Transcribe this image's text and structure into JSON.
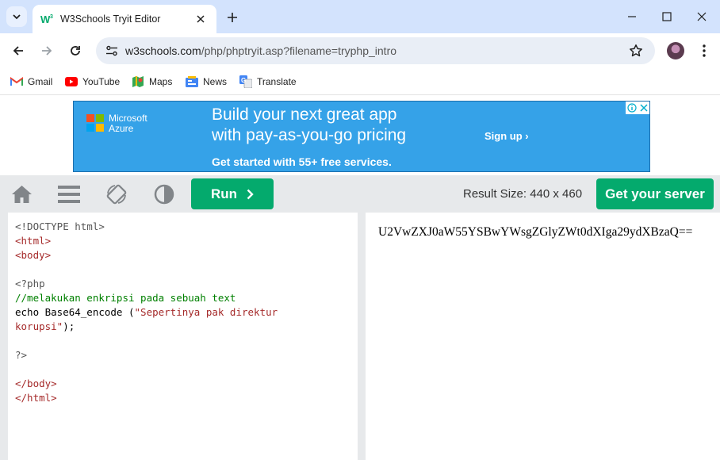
{
  "browser": {
    "tab": {
      "title": "W3Schools Tryit Editor"
    },
    "url": {
      "host": "w3schools.com",
      "path": "/php/phptryit.asp?filename=tryphp_intro"
    },
    "bookmarks": [
      {
        "label": "Gmail",
        "icon": "gmail-icon"
      },
      {
        "label": "YouTube",
        "icon": "youtube-icon"
      },
      {
        "label": "Maps",
        "icon": "maps-icon"
      },
      {
        "label": "News",
        "icon": "news-icon"
      },
      {
        "label": "Translate",
        "icon": "translate-icon"
      }
    ]
  },
  "ad": {
    "brand_line1": "Microsoft",
    "brand_line2": "Azure",
    "headline_line1": "Build your next great app",
    "headline_line2": "with pay-as-you-go pricing",
    "subline": "Get started with 55+ free services.",
    "cta": "Sign up ›"
  },
  "toolbar": {
    "run_label": "Run",
    "result_size": "Result Size: 440 x 460",
    "server_label": "Get your server"
  },
  "code": {
    "doctype": "<!DOCTYPE html>",
    "html_open": "<html>",
    "body_open": "<body>",
    "php_open": "<?php",
    "comment": "//melakukan enkripsi pada sebuah text",
    "echo_prefix": "echo Base64_encode (",
    "string_line1": "\"Sepertinya pak direktur",
    "string_line2": "korupsi\"",
    "echo_suffix": ");",
    "php_close": "?>",
    "body_close": "</body>",
    "html_close": "</html>"
  },
  "result": {
    "output": "U2VwZXJ0aW55YSBwYWsgZGlyZWt0dXIga29ydXBzaQ=="
  },
  "colors": {
    "accent_green": "#04aa6d",
    "tabstrip": "#d3e3fd",
    "ad_background": "#35a2e8",
    "panel_grey": "#e7e9eb"
  }
}
